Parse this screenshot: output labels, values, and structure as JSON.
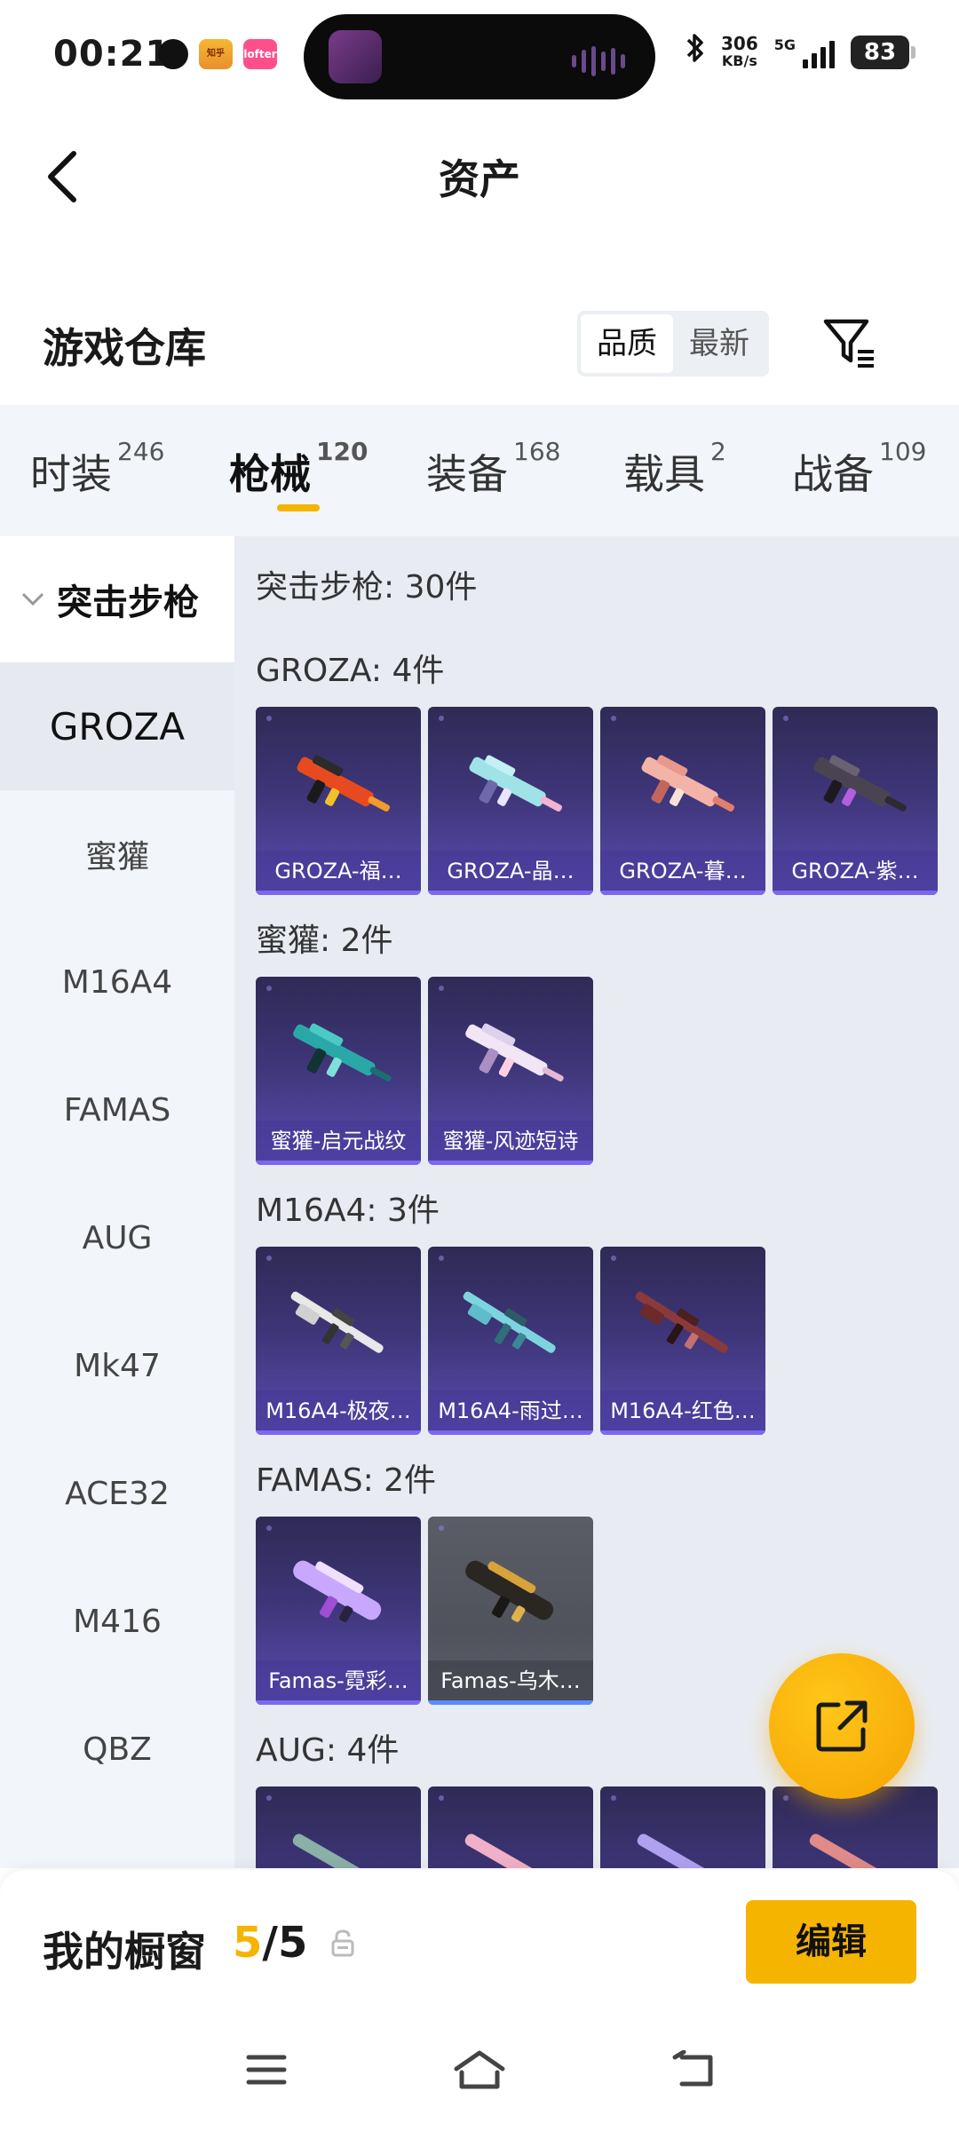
{
  "status_bar": {
    "time": "00:21",
    "app_badge_1": "知乎",
    "app_badge_2": "lofter",
    "net_speed_value": "306",
    "net_speed_unit": "KB/s",
    "network": "5G",
    "battery": "83"
  },
  "header": {
    "title": "资产"
  },
  "warehouse": {
    "title": "游戏仓库",
    "sort_options": [
      "品质",
      "最新"
    ],
    "active_sort": "品质"
  },
  "tabs": [
    {
      "label": "时装",
      "count": "246"
    },
    {
      "label": "枪械",
      "count": "120"
    },
    {
      "label": "装备",
      "count": "168"
    },
    {
      "label": "载具",
      "count": "2"
    },
    {
      "label": "战备",
      "count": "109"
    }
  ],
  "active_tab": "枪械",
  "sidebar": {
    "group": "突击步枪",
    "items": [
      "GROZA",
      "蜜獾",
      "M16A4",
      "FAMAS",
      "AUG",
      "Mk47",
      "ACE32",
      "M416",
      "QBZ"
    ],
    "active": "GROZA"
  },
  "content": {
    "total": "突击步枪: 30件",
    "groups": [
      {
        "label": "GROZA: 4件",
        "cards": [
          "GROZA-福…",
          "GROZA-晶…",
          "GROZA-暮…",
          "GROZA-紫…"
        ]
      },
      {
        "label": "蜜獾: 2件",
        "cards": [
          "蜜獾-启元战纹",
          "蜜獾-风迹短诗"
        ]
      },
      {
        "label": "M16A4: 3件",
        "cards": [
          "M16A4-极夜…",
          "M16A4-雨过…",
          "M16A4-红色…"
        ]
      },
      {
        "label": "FAMAS: 2件",
        "cards": [
          "Famas-霓彩…",
          "Famas-乌木…"
        ]
      },
      {
        "label": "AUG: 4件",
        "cards": [
          "",
          "",
          "",
          ""
        ]
      }
    ]
  },
  "bottom": {
    "showcase_label": "我的橱窗",
    "count_current": "5",
    "count_sep_total": "/5",
    "edit_label": "编辑"
  },
  "colors": {
    "accent": "#f5b400",
    "card_purple": "#3d3577",
    "card_grey": "#55585f"
  }
}
